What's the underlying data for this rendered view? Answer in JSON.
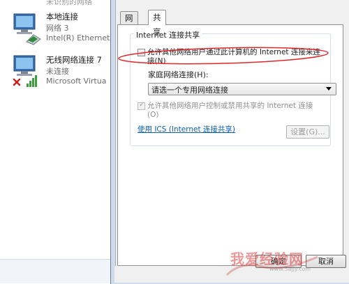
{
  "background_list": {
    "top_partial": "未识别的网络",
    "items": [
      {
        "name": "本地连接",
        "status": "网络  3",
        "device": "Intel(R) Ethernet"
      },
      {
        "name": "无线网络连接 7",
        "status": "未连接",
        "device": "Microsoft Virtua"
      }
    ]
  },
  "dialog": {
    "tabs": [
      "网络",
      "共享"
    ],
    "active_tab": "共享",
    "group_title": "Internet 连接共享",
    "allow_share": {
      "label": "允许其他网络用户通过此计算机的 Internet 连接来连接(N)",
      "checked": false
    },
    "home_network_label": "家庭网络连接(H):",
    "home_network_select": "请选一个专用网络连接",
    "allow_control": {
      "label": "允许其他网络用户控制或禁用共享的 Internet 连接(O)",
      "checked": true,
      "disabled": true
    },
    "ics_link": "使用 ICS (Internet 连接共享)",
    "settings_button": "设置(G)...",
    "ok_button": "确定",
    "cancel_button": "取消"
  },
  "watermark": {
    "text": "我爱经验网",
    "url": "www.5ajjy.com"
  },
  "colors": {
    "annotation": "#e0262b",
    "link": "#0a5fb4"
  }
}
